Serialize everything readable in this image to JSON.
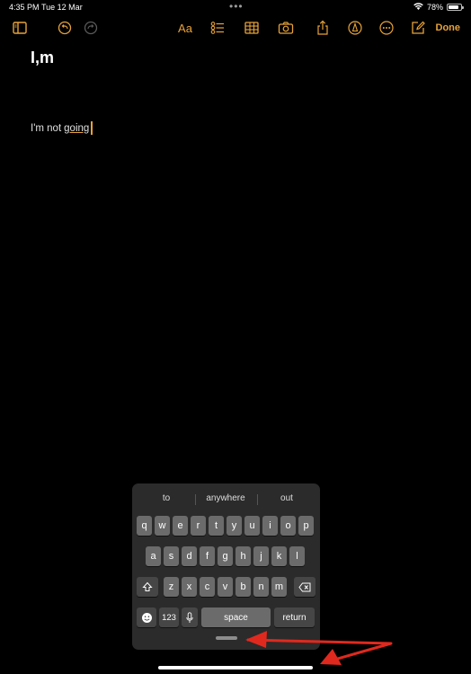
{
  "status_bar": {
    "time": "4:35 PM",
    "date": "Tue 12 Mar",
    "dots": "•••",
    "battery_percent": "78%",
    "wifi_icon": "wifi-icon",
    "battery_level": 0.78
  },
  "toolbar": {
    "left_icons": [
      "sidebar-icon",
      "undo-icon",
      "redo-icon"
    ],
    "right_icons": [
      "format-icon",
      "checklist-icon",
      "table-icon",
      "camera-icon",
      "share-icon",
      "markup-icon",
      "more-icon",
      "compose-icon"
    ],
    "format_label": "Aa",
    "done_label": "Done",
    "accent_color": "#e8a33a"
  },
  "note": {
    "title": "I,m",
    "body_prefix": "I'm not",
    "body_underlined": "going"
  },
  "keyboard": {
    "suggestions": [
      "to",
      "anywhere",
      "out"
    ],
    "row1": [
      "q",
      "w",
      "e",
      "r",
      "t",
      "y",
      "u",
      "i",
      "o",
      "p"
    ],
    "row2": [
      "a",
      "s",
      "d",
      "f",
      "g",
      "h",
      "j",
      "k",
      "l"
    ],
    "row3": [
      "z",
      "x",
      "c",
      "v",
      "b",
      "n",
      "m"
    ],
    "numbers_label": "123",
    "space_label": "space",
    "return_label": "return"
  }
}
